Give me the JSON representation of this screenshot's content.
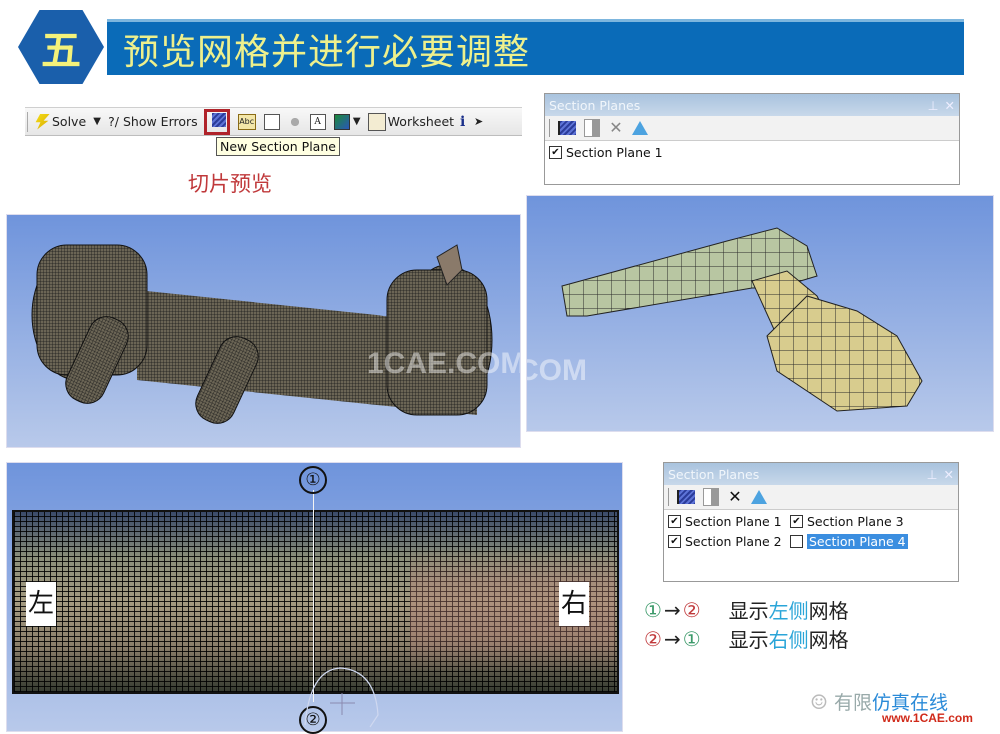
{
  "header": {
    "section_number": "五",
    "title": "预览网格并进行必要调整"
  },
  "toolbar": {
    "solve_label": "Solve",
    "dropdown_arrow": "▼",
    "show_errors_label": "?/ Show Errors",
    "new_section_plane_icon": "new-section-plane-icon",
    "annotation_icon": "Abc",
    "text_icon": "A",
    "worksheet_label": "Worksheet",
    "info_icon": "i",
    "tooltip": "New Section Plane",
    "highlight_color": "#b0232a"
  },
  "caption_slice_preview": "切片预览",
  "panel_top": {
    "title": "Section Planes",
    "pin": "⊥",
    "close": "✕",
    "items": [
      {
        "label": "Section Plane 1",
        "checked": true
      }
    ]
  },
  "panel_bottom": {
    "title": "Section Planes",
    "pin": "⊥",
    "close": "✕",
    "items": [
      {
        "label": "Section Plane 1",
        "checked": true
      },
      {
        "label": "Section Plane 3",
        "checked": true
      },
      {
        "label": "Section Plane 2",
        "checked": true
      },
      {
        "label": "Section Plane 4",
        "checked": false,
        "selected": true
      }
    ]
  },
  "views": {
    "watermark": "1CAE.COM",
    "left_label": "左",
    "right_label": "右",
    "marker_1": "①",
    "marker_2": "②"
  },
  "legend": [
    {
      "from": "①",
      "to": "②",
      "prefix": "显示",
      "highlight": "左侧",
      "suffix": "网格"
    },
    {
      "from": "②",
      "to": "①",
      "prefix": "显示",
      "highlight": "右侧",
      "suffix": "网格"
    }
  ],
  "arrow": "→",
  "footer": {
    "logo_text_gray": "有限",
    "logo_text_blue": "仿真在线",
    "url": "www.1CAE.com"
  }
}
